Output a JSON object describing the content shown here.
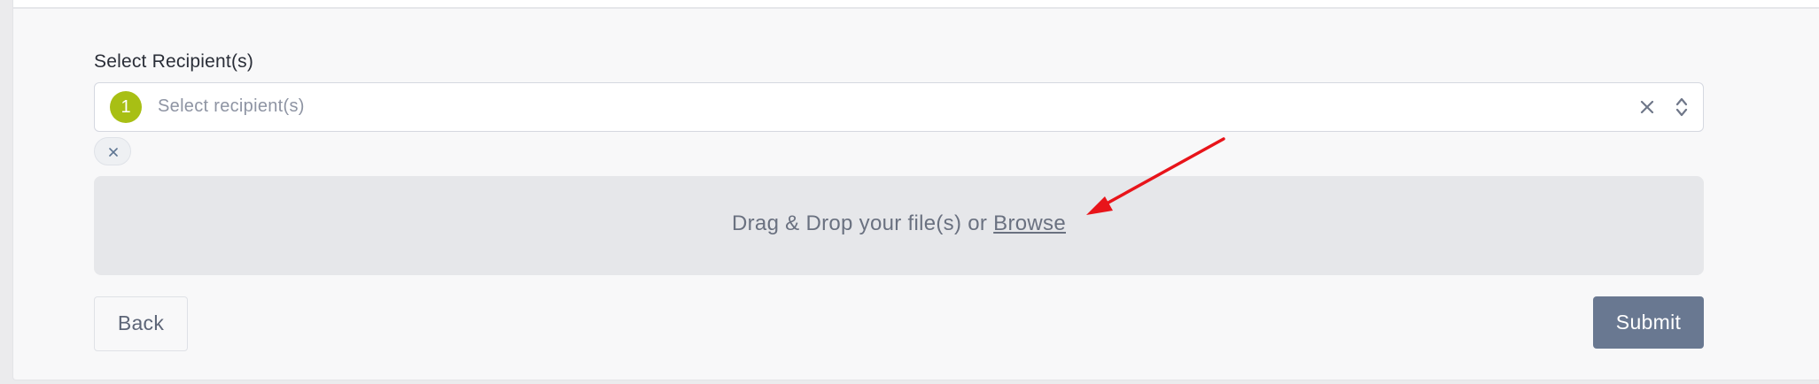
{
  "form": {
    "recipients_label": "Select Recipient(s)",
    "recipients_count": "1",
    "recipients_placeholder": "Select recipient(s)",
    "recipients_value": ""
  },
  "upload": {
    "prompt_text": "Drag & Drop your file(s) or ",
    "browse_label": "Browse"
  },
  "actions": {
    "back_label": "Back",
    "submit_label": "Submit"
  },
  "icons": {
    "clear": "close-icon",
    "toggle": "chevron-updown-icon",
    "chip_remove": "close-icon",
    "annotation": "red-arrow-annotation"
  },
  "colors": {
    "badge": "#a8bf14",
    "submit": "#697891",
    "annotation": "#e8141a"
  }
}
